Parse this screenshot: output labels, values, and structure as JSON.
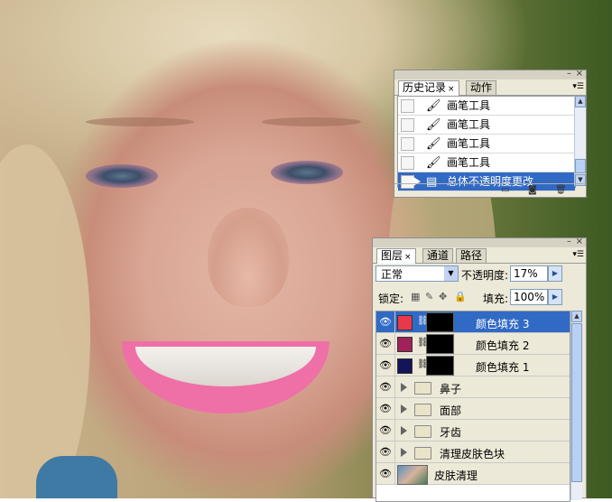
{
  "history_panel": {
    "tabs": [
      {
        "label": "历史记录",
        "close": "×",
        "active": true
      },
      {
        "label": "动作",
        "active": false
      }
    ],
    "items": [
      {
        "label": "画笔工具",
        "selected": false
      },
      {
        "label": "画笔工具",
        "selected": false
      },
      {
        "label": "画笔工具",
        "selected": false
      },
      {
        "label": "画笔工具",
        "selected": false
      },
      {
        "label": "总体不透明度更改",
        "selected": true
      }
    ],
    "window_controls": {
      "minimize": "–",
      "close": "×"
    },
    "icons": [
      "new-document-icon",
      "camera-icon",
      "trash-icon"
    ]
  },
  "layers_panel": {
    "tabs": [
      {
        "label": "图层",
        "close": "×",
        "active": true
      },
      {
        "label": "通道",
        "active": false
      },
      {
        "label": "路径",
        "active": false
      }
    ],
    "window_controls": {
      "minimize": "–",
      "close": "×"
    },
    "blend_mode": "正常",
    "opacity_label": "不透明度:",
    "opacity_value": "17%",
    "lock_label": "锁定:",
    "fill_label": "填充:",
    "fill_value": "100%",
    "layers": [
      {
        "name": "颜色填充 3",
        "type": "fill",
        "color": "#e8394a",
        "selected": true
      },
      {
        "name": "颜色填充 2",
        "type": "fill",
        "color": "#a0225a",
        "selected": false
      },
      {
        "name": "颜色填充 1",
        "type": "fill",
        "color": "#141458",
        "selected": false
      },
      {
        "name": "鼻子",
        "type": "group"
      },
      {
        "name": "面部",
        "type": "group"
      },
      {
        "name": "牙齿",
        "type": "group"
      },
      {
        "name": "清理皮肤色块",
        "type": "group"
      },
      {
        "name": "皮肤清理",
        "type": "image"
      }
    ]
  },
  "colors": {
    "selection": "#316ac5",
    "panel_bg": "#ece9d8"
  }
}
